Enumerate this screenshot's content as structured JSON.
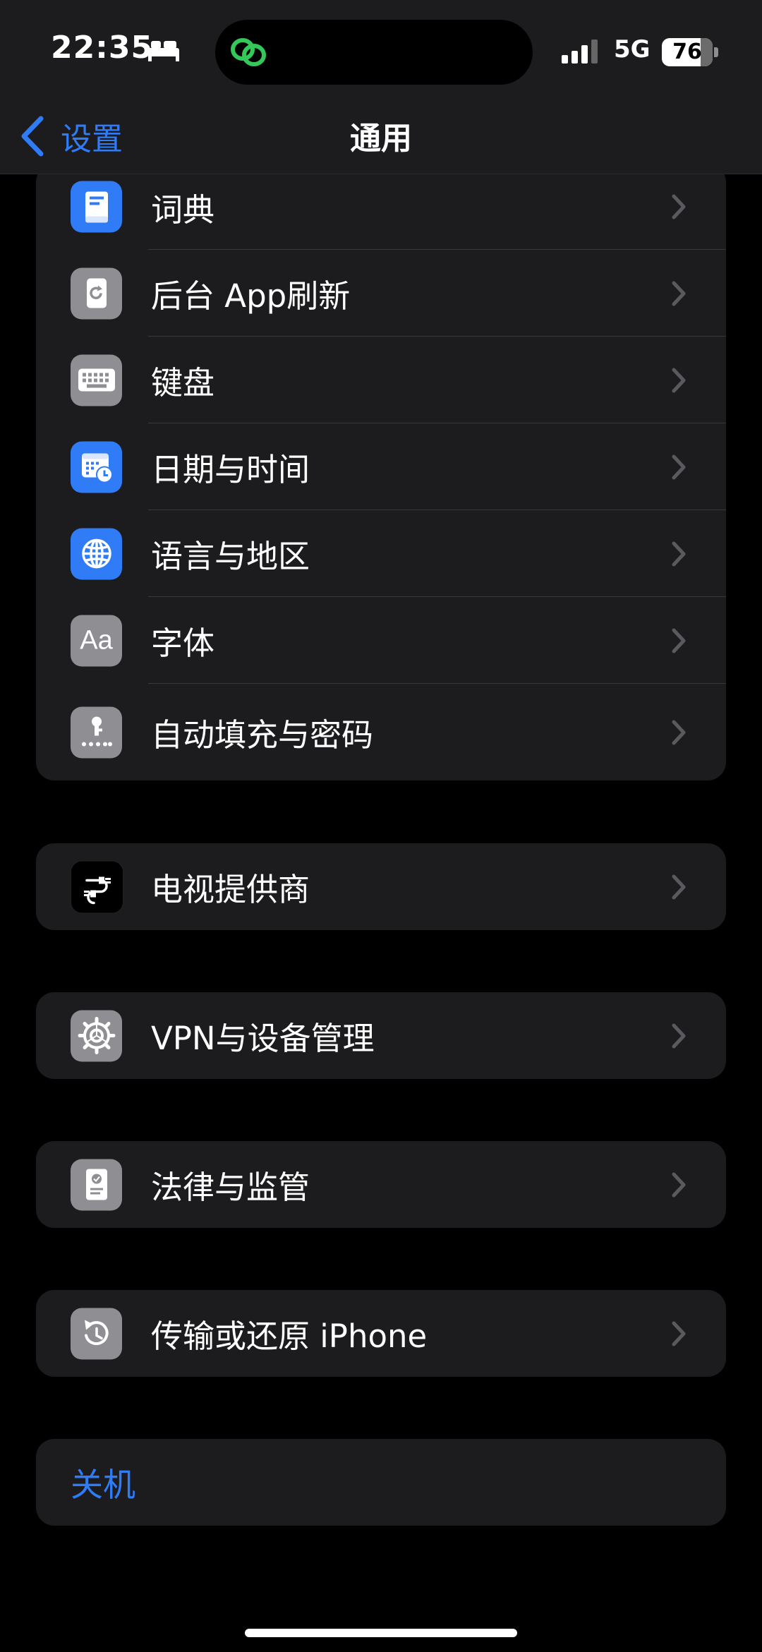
{
  "status": {
    "time": "22:35",
    "network": "5G",
    "battery_percent": "76",
    "battery_level": 0.76
  },
  "nav": {
    "back_label": "设置",
    "title": "通用"
  },
  "group1": [
    {
      "label": "词典",
      "icon": "dictionary-icon"
    },
    {
      "label": "后台 App刷新",
      "icon": "background-refresh-icon"
    },
    {
      "label": "键盘",
      "icon": "keyboard-icon"
    },
    {
      "label": "日期与时间",
      "icon": "calendar-clock-icon"
    },
    {
      "label": "语言与地区",
      "icon": "globe-icon"
    },
    {
      "label": "字体",
      "icon": "font-icon",
      "icon_text": "Aa"
    },
    {
      "label": "自动填充与密码",
      "icon": "key-icon"
    }
  ],
  "tv_provider": {
    "label": "电视提供商",
    "icon": "tv-provider-icon"
  },
  "vpn": {
    "label": "VPN与设备管理",
    "icon": "gear-icon"
  },
  "legal": {
    "label": "法律与监管",
    "icon": "certificate-icon"
  },
  "transfer": {
    "label": "传输或还原 iPhone",
    "icon": "reset-icon"
  },
  "shutdown": {
    "label": "关机"
  },
  "colors": {
    "accent": "#2f7cf6",
    "cell_background": "#1c1c1e",
    "background": "#000000"
  }
}
